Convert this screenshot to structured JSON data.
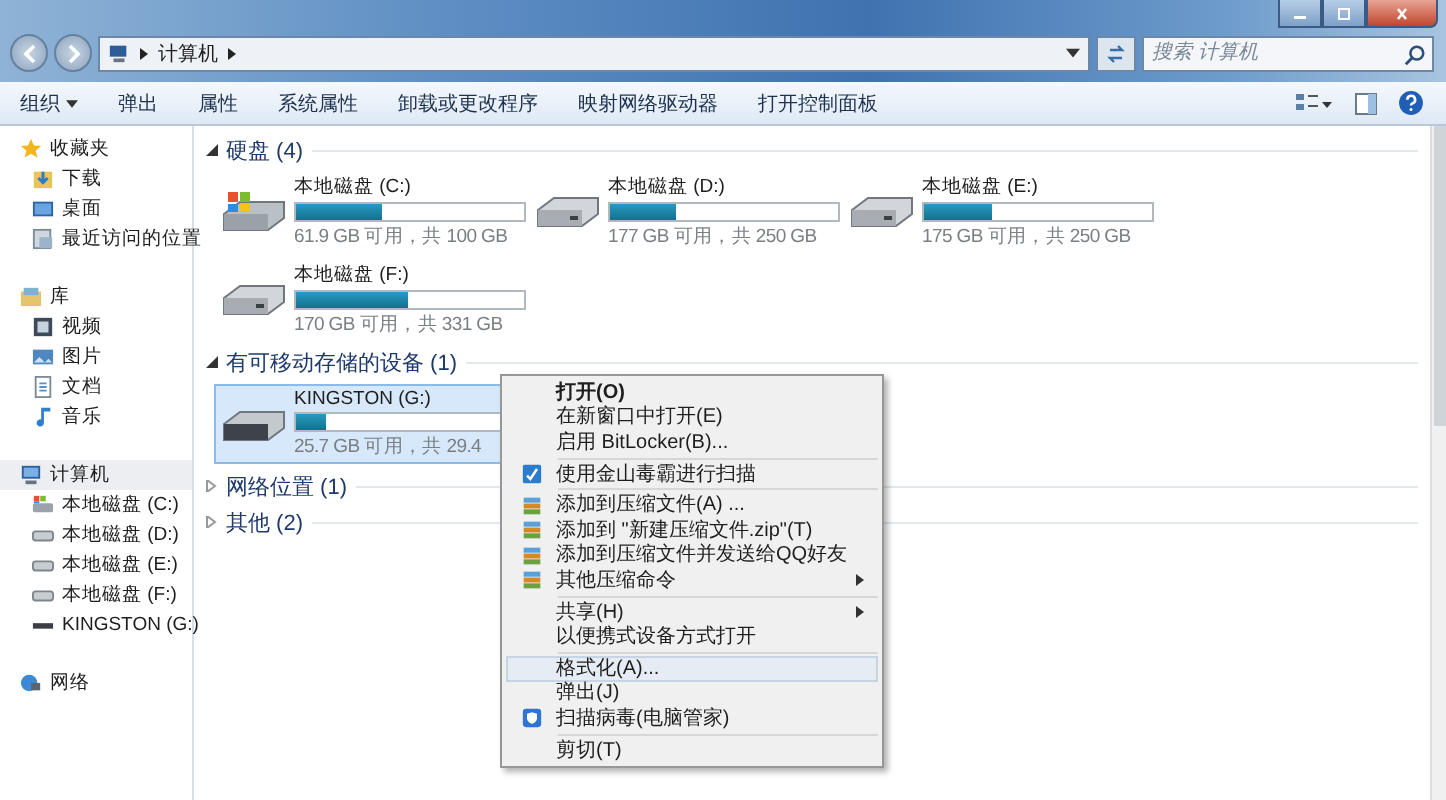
{
  "address": {
    "crumbs": [
      "计算机"
    ],
    "search_placeholder": "搜索 计算机"
  },
  "toolbar": {
    "buttons": [
      {
        "label": "组织",
        "dropdown": true
      },
      {
        "label": "弹出",
        "dropdown": false
      },
      {
        "label": "属性",
        "dropdown": false
      },
      {
        "label": "系统属性",
        "dropdown": false
      },
      {
        "label": "卸载或更改程序",
        "dropdown": false
      },
      {
        "label": "映射网络驱动器",
        "dropdown": false
      },
      {
        "label": "打开控制面板",
        "dropdown": false
      }
    ]
  },
  "sidebar": {
    "items": [
      {
        "label": "收藏夹",
        "kind": "star",
        "selected": false,
        "children": [
          {
            "label": "下载",
            "kind": "download"
          },
          {
            "label": "桌面",
            "kind": "desktop"
          },
          {
            "label": "最近访问的位置",
            "kind": "recent"
          }
        ]
      },
      {
        "label": "库",
        "kind": "library",
        "selected": false,
        "children": [
          {
            "label": "视频",
            "kind": "video"
          },
          {
            "label": "图片",
            "kind": "picture"
          },
          {
            "label": "文档",
            "kind": "document"
          },
          {
            "label": "音乐",
            "kind": "music"
          }
        ]
      },
      {
        "label": "计算机",
        "kind": "computer",
        "selected": true,
        "children": [
          {
            "label": "本地磁盘 (C:)",
            "kind": "system-drive"
          },
          {
            "label": "本地磁盘 (D:)",
            "kind": "drive"
          },
          {
            "label": "本地磁盘 (E:)",
            "kind": "drive"
          },
          {
            "label": "本地磁盘 (F:)",
            "kind": "drive"
          },
          {
            "label": "KINGSTON (G:)",
            "kind": "usb"
          }
        ]
      },
      {
        "label": "网络",
        "kind": "network",
        "selected": false
      }
    ]
  },
  "groups": [
    {
      "title": "硬盘 (4)",
      "expanded": true,
      "drives": [
        {
          "name": "本地磁盘 (C:)",
          "kind": "system-drive",
          "level": 0.38,
          "info": "61.9 GB 可用，共 100 GB",
          "selected": false
        },
        {
          "name": "本地磁盘 (D:)",
          "kind": "drive",
          "level": 0.29,
          "info": "177 GB 可用，共 250 GB",
          "selected": false
        },
        {
          "name": "本地磁盘 (E:)",
          "kind": "drive",
          "level": 0.3,
          "info": "175 GB 可用，共 250 GB",
          "selected": false
        },
        {
          "name": "本地磁盘 (F:)",
          "kind": "drive",
          "level": 0.49,
          "info": "170 GB 可用，共 331 GB",
          "selected": false
        }
      ]
    },
    {
      "title": "有可移动存储的设备 (1)",
      "expanded": true,
      "drives": [
        {
          "name": "KINGSTON (G:)",
          "kind": "usb",
          "level": 0.13,
          "info": "25.7 GB 可用，共 29.4",
          "selected": true
        }
      ]
    },
    {
      "title": "网络位置 (1)",
      "expanded": false
    },
    {
      "title": "其他 (2)",
      "expanded": false
    }
  ],
  "context_menu": {
    "items": [
      {
        "kind": "plain",
        "label": "打开(O)",
        "bold": true,
        "submenu": false,
        "selected": false
      },
      {
        "kind": "plain",
        "label": "在新窗口中打开(E)",
        "bold": false,
        "submenu": false,
        "selected": false
      },
      {
        "kind": "plain",
        "label": "启用 BitLocker(B)...",
        "bold": false,
        "submenu": false,
        "selected": false
      },
      {
        "kind": "separator"
      },
      {
        "kind": "antivirus",
        "label": "使用金山毒霸进行扫描",
        "bold": false,
        "submenu": false,
        "selected": false
      },
      {
        "kind": "separator"
      },
      {
        "kind": "archive",
        "label": "添加到压缩文件(A) ...",
        "bold": false,
        "submenu": false,
        "selected": false
      },
      {
        "kind": "archive",
        "label": "添加到 \"新建压缩文件.zip\"(T)",
        "bold": false,
        "submenu": false,
        "selected": false
      },
      {
        "kind": "archive",
        "label": "添加到压缩文件并发送给QQ好友",
        "bold": false,
        "submenu": false,
        "selected": false
      },
      {
        "kind": "archive",
        "label": "其他压缩命令",
        "bold": false,
        "submenu": true,
        "selected": false
      },
      {
        "kind": "separator"
      },
      {
        "kind": "plain",
        "label": "共享(H)",
        "bold": false,
        "submenu": true,
        "selected": false
      },
      {
        "kind": "plain",
        "label": "以便携式设备方式打开",
        "bold": false,
        "submenu": false,
        "selected": false
      },
      {
        "kind": "separator"
      },
      {
        "kind": "plain",
        "label": "格式化(A)...",
        "bold": false,
        "submenu": false,
        "selected": true
      },
      {
        "kind": "plain",
        "label": "弹出(J)",
        "bold": false,
        "submenu": false,
        "selected": false
      },
      {
        "kind": "shield",
        "label": "扫描病毒(电脑管家)",
        "bold": false,
        "submenu": false,
        "selected": false
      },
      {
        "kind": "separator"
      },
      {
        "kind": "plain",
        "label": "剪切(T)",
        "bold": false,
        "submenu": false,
        "selected": false
      }
    ]
  }
}
